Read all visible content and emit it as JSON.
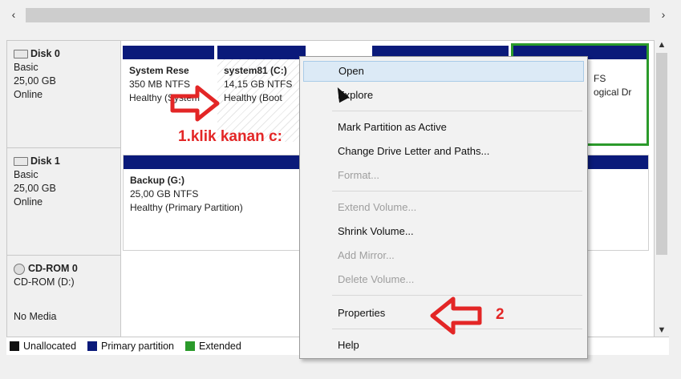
{
  "scroll": {
    "left_glyph": "‹",
    "right_glyph": "›",
    "up_glyph": "▲",
    "down_glyph": "▼"
  },
  "disks": [
    {
      "name": "Disk 0",
      "type": "Basic",
      "size": "25,00 GB",
      "status": "Online"
    },
    {
      "name": "Disk 1",
      "type": "Basic",
      "size": "25,00 GB",
      "status": "Online"
    },
    {
      "name": "CD-ROM 0",
      "type": "CD-ROM (D:)",
      "status": "No Media"
    }
  ],
  "partitions": {
    "disk0": [
      {
        "name": "System Rese",
        "line2": "350 MB NTFS",
        "line3": "Healthy (System"
      },
      {
        "name": "system81  (C:)",
        "line2": "14,15 GB NTFS",
        "line3": "Healthy (Boot"
      },
      {
        "name": "",
        "line2": "",
        "line3": ""
      },
      {
        "name": "",
        "line2": "FS",
        "line3": "ogical Dr"
      }
    ],
    "disk1": [
      {
        "name": "Backup  (G:)",
        "line2": "25,00 GB NTFS",
        "line3": "Healthy (Primary Partition)"
      }
    ]
  },
  "legend": [
    {
      "label": "Unallocated",
      "color": "#111111"
    },
    {
      "label": "Primary partition",
      "color": "#0a1a7a"
    },
    {
      "label": "Extended",
      "color": "#2b9a2b"
    }
  ],
  "context_menu": [
    {
      "label": "Open",
      "enabled": true,
      "highlighted": true
    },
    {
      "label": "Explore",
      "enabled": true
    },
    {
      "label": "Mark Partition as Active",
      "enabled": true
    },
    {
      "label": "Change Drive Letter and Paths...",
      "enabled": true
    },
    {
      "label": "Format...",
      "enabled": false
    },
    {
      "label": "Extend Volume...",
      "enabled": false
    },
    {
      "label": "Shrink Volume...",
      "enabled": true
    },
    {
      "label": "Add Mirror...",
      "enabled": false
    },
    {
      "label": "Delete Volume...",
      "enabled": false
    },
    {
      "label": "Properties",
      "enabled": true
    },
    {
      "label": "Help",
      "enabled": true
    }
  ],
  "annotations": {
    "step1": "1.klik kanan c:",
    "step2": "2",
    "color": "#e32626"
  }
}
